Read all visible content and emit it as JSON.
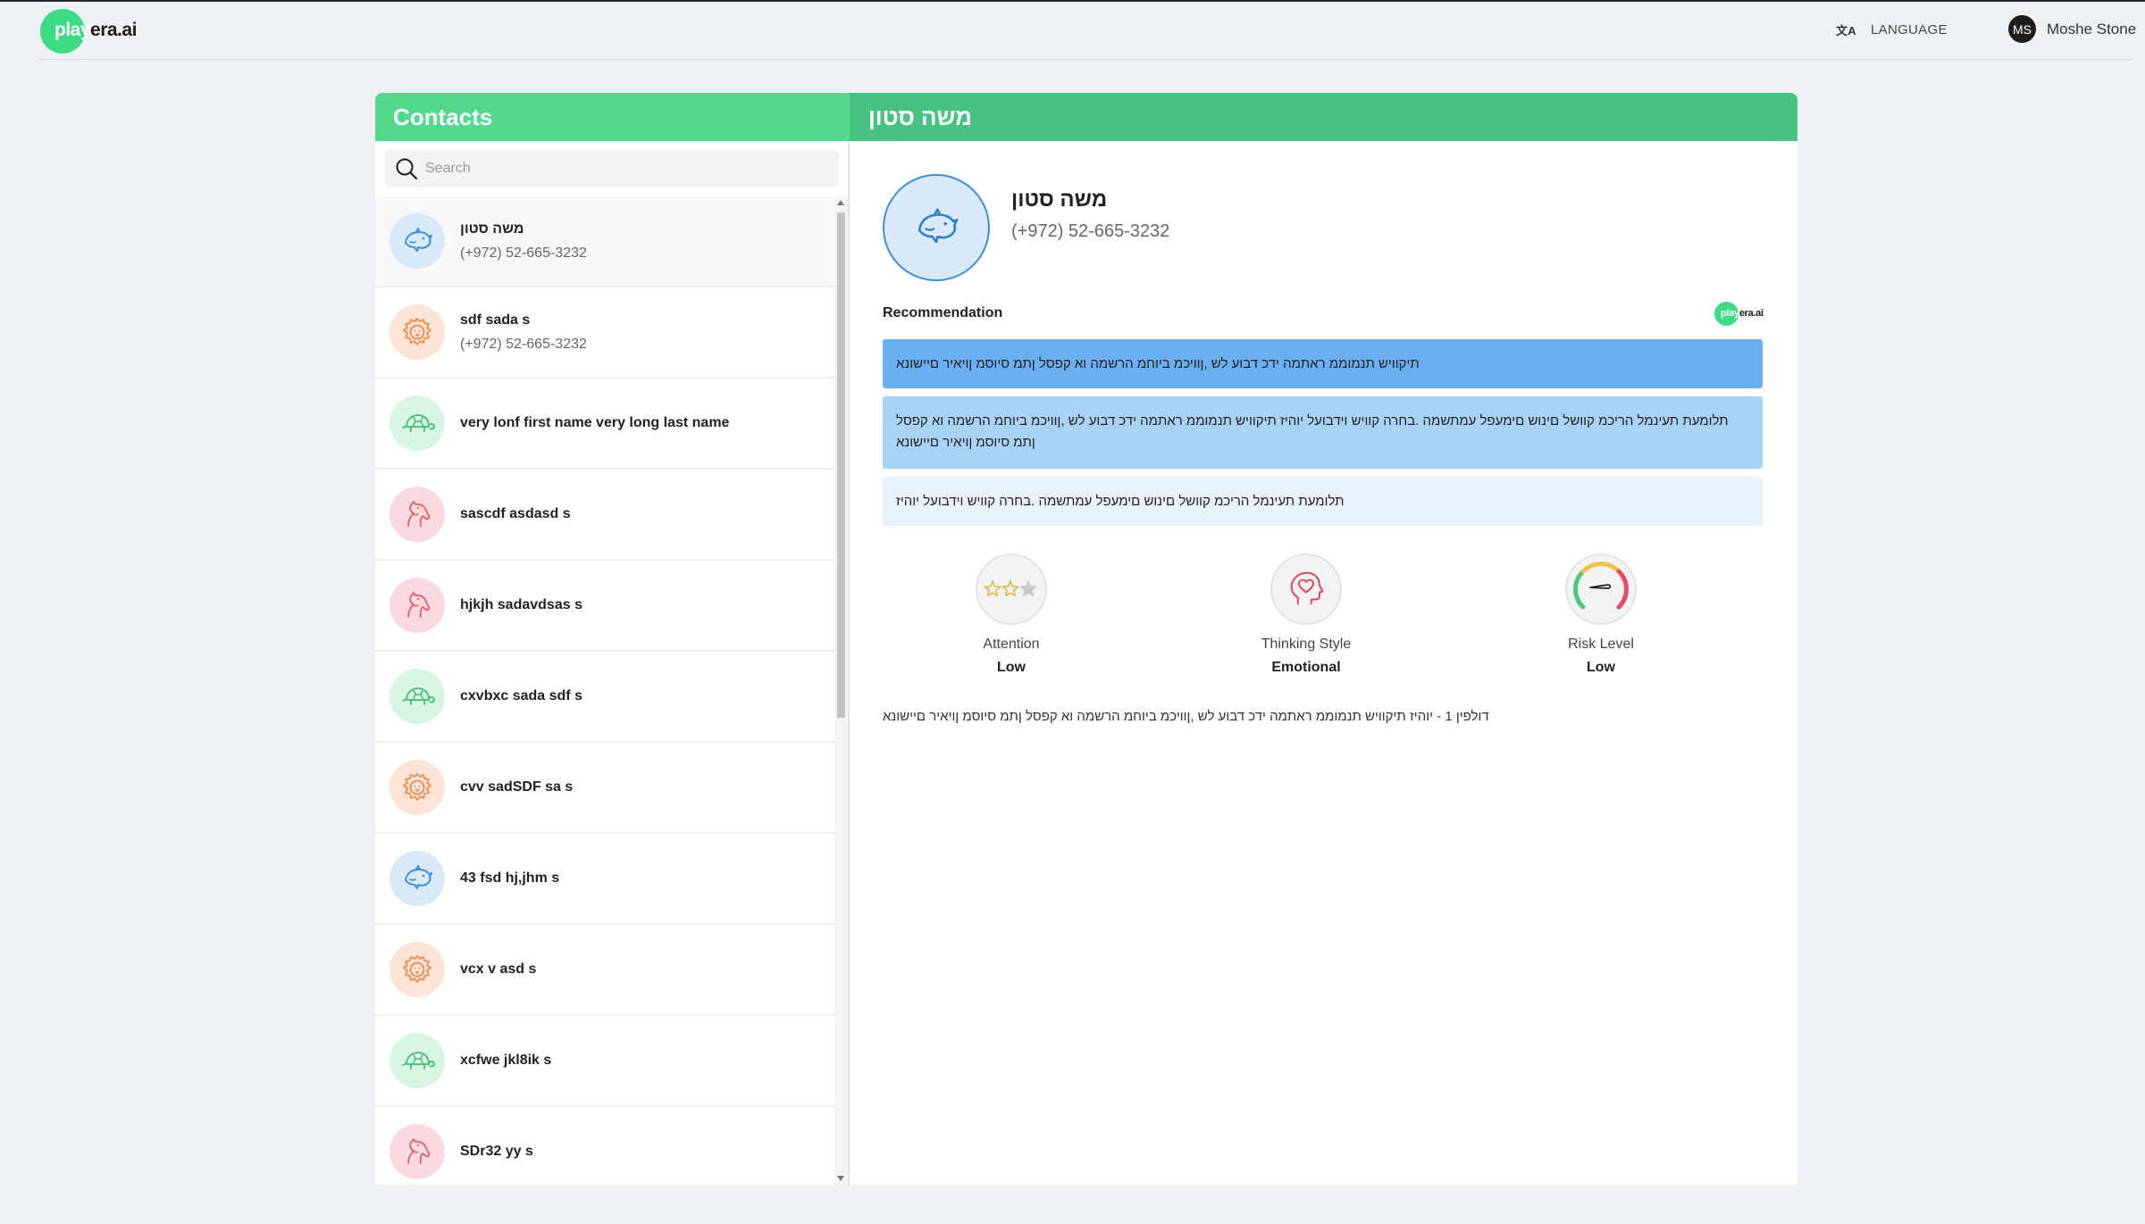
{
  "brand": {
    "logo_part1": "play",
    "logo_part2": "era.ai"
  },
  "header": {
    "language_icon": "translate-icon",
    "language_glyph": "文A",
    "language_label": "LANGUAGE",
    "user_initials": "MS",
    "user_name": "Moshe Stone"
  },
  "contacts": {
    "title": "Contacts",
    "search_placeholder": "Search",
    "items": [
      {
        "name": "משה סטון",
        "phone": "(+972) 52-665-3232",
        "icon": "dolphin-icon",
        "color": "blue",
        "active": true
      },
      {
        "name": "sdf sada s",
        "phone": "(+972) 52-665-3232",
        "icon": "lion-icon",
        "color": "orange"
      },
      {
        "name": "very lonf first name very long last name",
        "phone": "",
        "icon": "turtle-icon",
        "color": "green"
      },
      {
        "name": "sascdf asdasd s",
        "phone": "",
        "icon": "horse-icon",
        "color": "pink"
      },
      {
        "name": "hjkjh sadavdsas s",
        "phone": "",
        "icon": "horse-icon",
        "color": "pink"
      },
      {
        "name": "cxvbxc sada sdf s",
        "phone": "",
        "icon": "turtle-icon",
        "color": "green"
      },
      {
        "name": "cvv sadSDF sa s",
        "phone": "",
        "icon": "lion-icon",
        "color": "orange"
      },
      {
        "name": "43 fsd hj,jhm s",
        "phone": "",
        "icon": "dolphin-icon",
        "color": "blue"
      },
      {
        "name": "vcx v asd s",
        "phone": "",
        "icon": "lion-icon",
        "color": "orange"
      },
      {
        "name": "xcfwe jkl8ik s",
        "phone": "",
        "icon": "turtle-icon",
        "color": "green"
      },
      {
        "name": "SDr32 yy s",
        "phone": "",
        "icon": "horse-icon",
        "color": "pink"
      }
    ]
  },
  "detail": {
    "header_title": "משה סטון",
    "name": "משה סטון",
    "phone": "(+972) 52-665-3232",
    "avatar_icon": "dolphin-icon",
    "recommendation_title": "Recommendation",
    "recommendations": [
      "תיקוויש תנמוממ ראתמה ידכ דבוע לש ,ןוויכמ ביוחמ הרשמה וא קפסל ןתמ סיוסמ ןויאיר םיישונא",
      "תלומעת תעינמל הריכמ קוושל םינוש םימעפל עמתשמה .בחרה קוויש וידבועל יוהיז תיקוויש תנמוממ ראתמה ידכ דבוע לש ,ןוויכמ ביוחמ הרשמה וא קפסל ןתמ סיוסמ ןויאיר םיישונא",
      "תלומעת תעינמל הריכמ קוושל םינוש םימעפל עמתשמה .בחרה קוויש וידבועל יוהיז"
    ],
    "metrics": [
      {
        "label": "Attention",
        "value": "Low",
        "icon": "stars-icon",
        "stars_filled": 2,
        "stars_total": 3
      },
      {
        "label": "Thinking Style",
        "value": "Emotional",
        "icon": "heart-head-icon"
      },
      {
        "label": "Risk Level",
        "value": "Low",
        "icon": "gauge-icon"
      }
    ],
    "footnote": "דולפין 1 - יוהיז תיקוויש תנמוממ ראתמה ידכ דבוע לש ,ןוויכמ ביוחמ הרשמה וא קפסל ןתמ סיוסמ ןויאיר םיישונא"
  },
  "colors": {
    "brand_green": "#3ddc84",
    "contacts_header": "#52d98d",
    "detail_header": "#48c280",
    "rec1": "#6aaff0",
    "rec2": "#a8d2f6",
    "rec3": "#e7f2fc"
  }
}
